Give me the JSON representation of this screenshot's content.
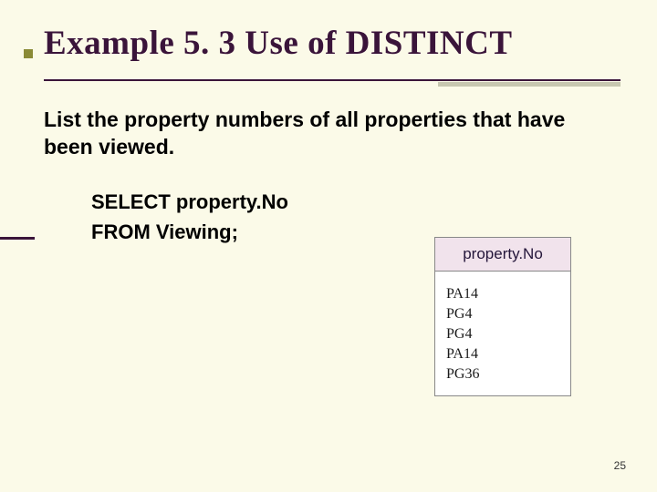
{
  "title": "Example 5. 3  Use of DISTINCT",
  "prompt": "List the property numbers of all properties that have been viewed.",
  "sql": {
    "line1": "SELECT property.No",
    "line2": "FROM Viewing;"
  },
  "result": {
    "header": "property.No",
    "rows": [
      "PA14",
      "PG4",
      "PG4",
      "PA14",
      "PG36"
    ]
  },
  "page_number": "25",
  "chart_data": {
    "type": "table",
    "title": "property.No",
    "categories": [
      "property.No"
    ],
    "series": [
      {
        "name": "property.No",
        "values": [
          "PA14",
          "PG4",
          "PG4",
          "PA14",
          "PG36"
        ]
      }
    ]
  }
}
